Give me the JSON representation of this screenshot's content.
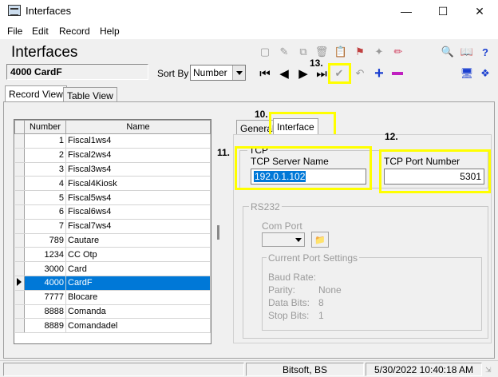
{
  "window": {
    "title": "Interfaces"
  },
  "menu": {
    "file": "File",
    "edit": "Edit",
    "record": "Record",
    "help": "Help"
  },
  "header": {
    "title": "Interfaces",
    "current_record": "4000 CardF",
    "sort_label": "Sort By",
    "sort_value": "Number"
  },
  "annotations": {
    "a10": "10.",
    "a11": "11.",
    "a12": "12.",
    "a13": "13."
  },
  "tabs": {
    "record_view": "Record View",
    "table_view": "Table View",
    "general": "General",
    "interface": "Interface"
  },
  "grid": {
    "col_number": "Number",
    "col_name": "Name",
    "rows": [
      {
        "number": "1",
        "name": "Fiscal1ws4"
      },
      {
        "number": "2",
        "name": "Fiscal2ws4"
      },
      {
        "number": "3",
        "name": "Fiscal3ws4"
      },
      {
        "number": "4",
        "name": "Fiscal4Kiosk"
      },
      {
        "number": "5",
        "name": "Fiscal5ws4"
      },
      {
        "number": "6",
        "name": "Fiscal6ws4"
      },
      {
        "number": "7",
        "name": "Fiscal7ws4"
      },
      {
        "number": "789",
        "name": "Cautare"
      },
      {
        "number": "1234",
        "name": "CC Otp"
      },
      {
        "number": "3000",
        "name": "Card"
      },
      {
        "number": "4000",
        "name": "CardF"
      },
      {
        "number": "7777",
        "name": "Blocare"
      },
      {
        "number": "8888",
        "name": "Comanda"
      },
      {
        "number": "8889",
        "name": "Comandadel"
      }
    ],
    "selected_index": 10
  },
  "tcp": {
    "group_label": "TCP",
    "server_label": "TCP Server Name",
    "server_value": "192.0.1.102",
    "port_label": "TCP Port Number",
    "port_value": "5301"
  },
  "rs232": {
    "group_label": "RS232",
    "com_port_label": "Com Port",
    "settings_label": "Current Port Settings",
    "baud_label": "Baud Rate:",
    "baud_value": "",
    "parity_label": "Parity:",
    "parity_value": "None",
    "databits_label": "Data Bits:",
    "databits_value": "8",
    "stopbits_label": "Stop Bits:",
    "stopbits_value": "1"
  },
  "status": {
    "user": "Bitsoft, BS",
    "datetime": "5/30/2022 10:40:18 AM"
  },
  "colors": {
    "highlight": "#ffff00",
    "selection": "#0078d7",
    "add": "#1a3fd0",
    "remove": "#c020c0"
  }
}
